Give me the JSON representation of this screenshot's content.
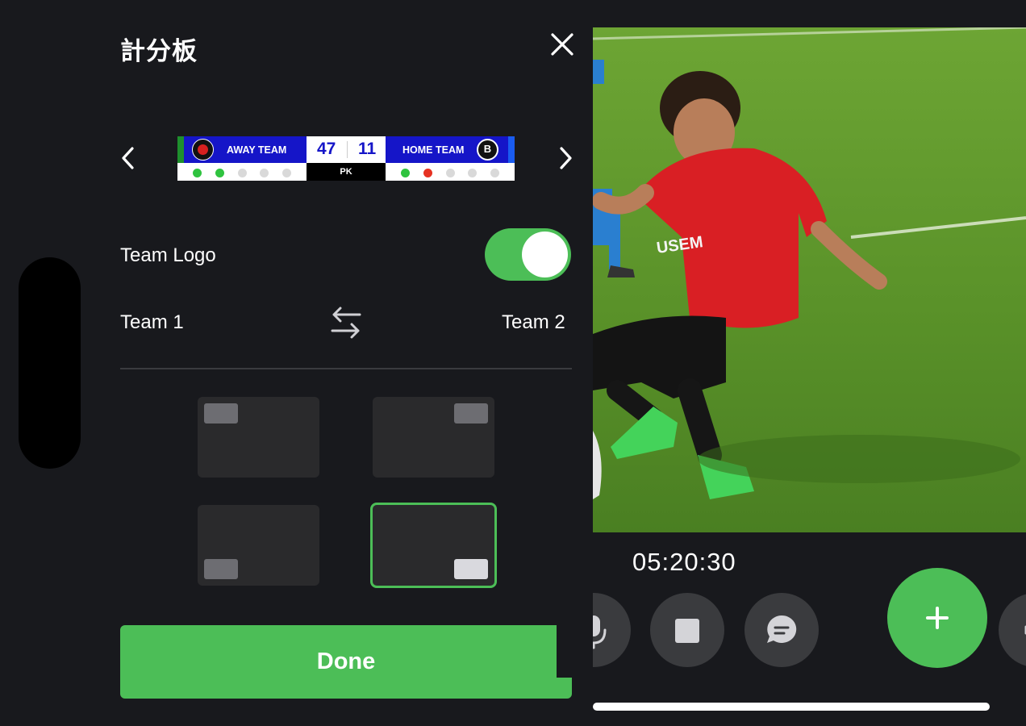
{
  "panel": {
    "title": "計分板",
    "close_icon": "close-icon",
    "prev_icon": "chevron-left-icon",
    "next_icon": "chevron-right-icon"
  },
  "scoreboard": {
    "away_team": "AWAY TEAM",
    "home_team": "HOME TEAM",
    "away_score": "47",
    "home_score": "11",
    "period": "PK",
    "away_shootout": [
      "scored",
      "scored",
      "pending",
      "pending",
      "pending"
    ],
    "home_shootout": [
      "scored",
      "missed",
      "pending",
      "pending",
      "pending"
    ],
    "colors": {
      "team_bar": "#1515c8",
      "away_accent": "#1e8f2d",
      "home_accent": "#1a5cf0",
      "scored": "#2fc33f",
      "missed": "#e63222",
      "pending": "#d9d9d9"
    }
  },
  "team_logo": {
    "label": "Team Logo",
    "enabled": true
  },
  "teams": {
    "team1": "Team 1",
    "team2": "Team 2",
    "swap_icon": "swap-arrows-icon"
  },
  "positions": {
    "options": [
      "top-left",
      "top-right",
      "bottom-left",
      "bottom-right"
    ],
    "selected": "bottom-right"
  },
  "done_label": "Done",
  "recording": {
    "timer": "05:20:30",
    "controls": [
      "microphone-icon",
      "stop-icon",
      "chat-icon",
      "add-icon"
    ]
  },
  "colors": {
    "accent": "#4cbe57",
    "background": "#18191d"
  }
}
